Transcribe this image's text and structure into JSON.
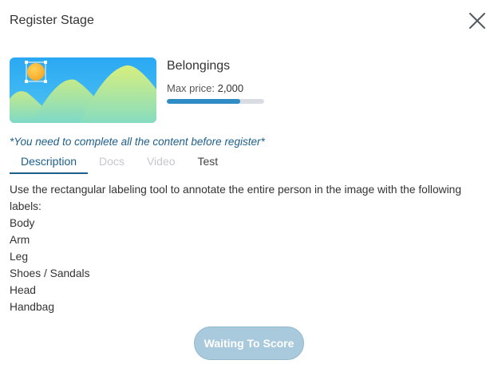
{
  "modal": {
    "title": "Register Stage"
  },
  "icons": {
    "close": "close-icon",
    "thumbnail": "image-placeholder-icon"
  },
  "stage": {
    "name": "Belongings",
    "price_label": "Max price:",
    "price_value": "2,000",
    "progress_fraction": 0.75
  },
  "notice": "*You need to complete all the content before register*",
  "tabs": [
    {
      "label": "Description",
      "state": "active"
    },
    {
      "label": "Docs",
      "state": "disabled"
    },
    {
      "label": "Video",
      "state": "disabled"
    },
    {
      "label": "Test",
      "state": "normal"
    }
  ],
  "description": {
    "intro": "Use the rectangular labeling tool to annotate the entire person in the image with the following labels:",
    "labels": [
      "Body",
      "Arm",
      "Leg",
      "Shoes / Sandals",
      "Head",
      "Handbag"
    ]
  },
  "action": {
    "label": "Waiting To Score",
    "disabled": true
  },
  "colors": {
    "accent": "#1d5f8a",
    "progress_fill": "#2f8cc4",
    "progress_track": "#d9dde3",
    "button_disabled": "#a9c9dc"
  }
}
